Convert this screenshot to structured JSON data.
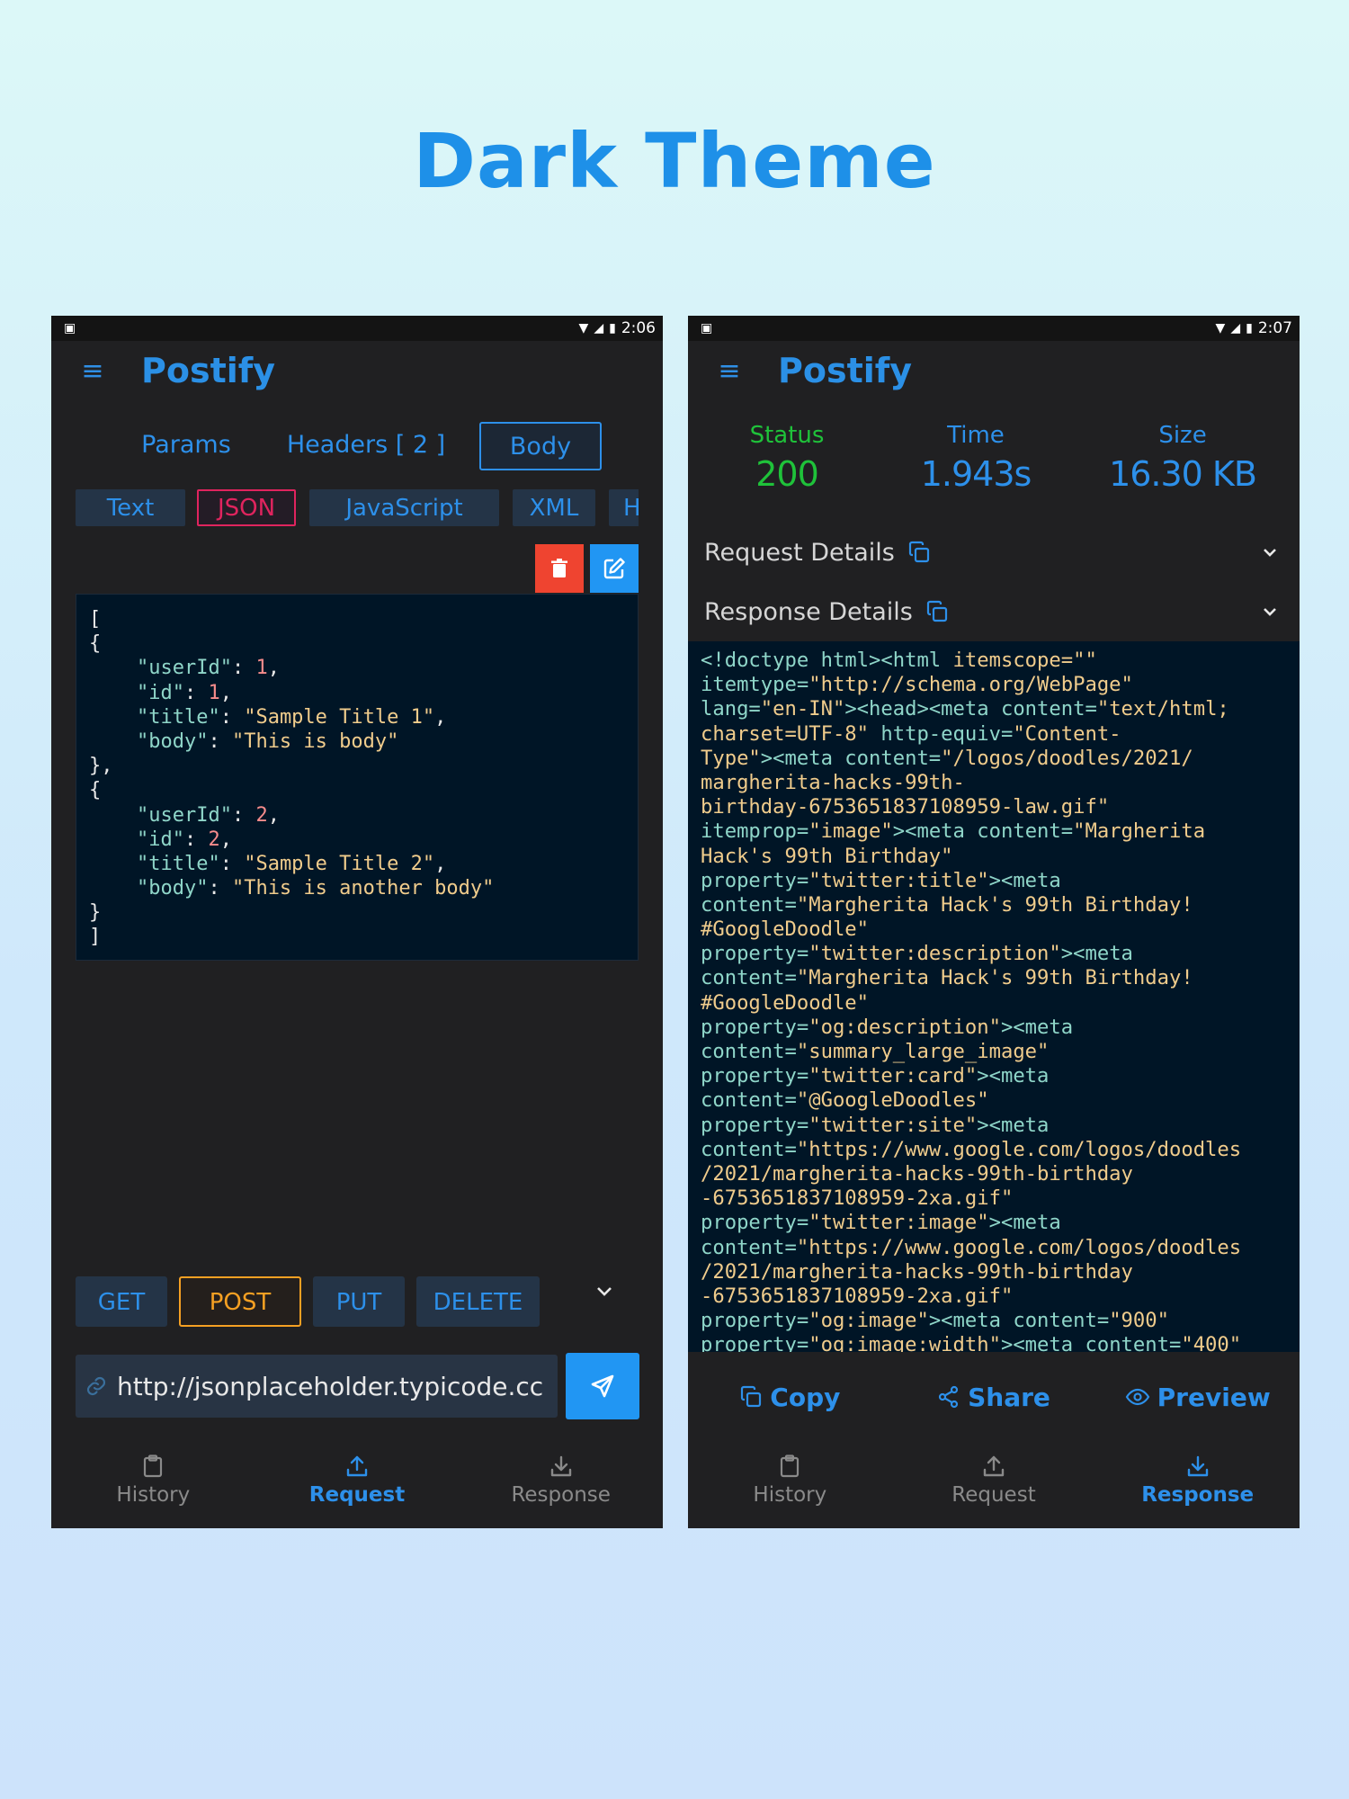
{
  "headline": "Dark Theme",
  "colors": {
    "accent": "#2d90ea",
    "status_green": "#1fc23a",
    "delete_red": "#ef4430",
    "json_pink": "#e0245e",
    "post_orange": "#f5a023",
    "background": "#202022",
    "editor_bg": "#001526"
  },
  "request_screen": {
    "status_bar": {
      "time": "2:06"
    },
    "app_title": "Postify",
    "tabs": [
      {
        "label": "Params"
      },
      {
        "label": "Headers [ 2 ]"
      },
      {
        "label": "Body",
        "active": true
      }
    ],
    "body_types": [
      {
        "label": "Text"
      },
      {
        "label": "JSON",
        "active": true
      },
      {
        "label": "JavaScript"
      },
      {
        "label": "XML"
      },
      {
        "label": "H"
      }
    ],
    "body_lines": [
      [
        {
          "t": "[",
          "c": "p"
        }
      ],
      [
        {
          "t": "{",
          "c": "p"
        }
      ],
      [
        {
          "t": "    \"userId\"",
          "c": "k"
        },
        {
          "t": ": ",
          "c": "p"
        },
        {
          "t": "1",
          "c": "n"
        },
        {
          "t": ",",
          "c": "p"
        }
      ],
      [
        {
          "t": "    \"id\"",
          "c": "k"
        },
        {
          "t": ": ",
          "c": "p"
        },
        {
          "t": "1",
          "c": "n"
        },
        {
          "t": ",",
          "c": "p"
        }
      ],
      [
        {
          "t": "    \"title\"",
          "c": "k"
        },
        {
          "t": ": ",
          "c": "p"
        },
        {
          "t": "\"Sample Title 1\"",
          "c": "s"
        },
        {
          "t": ",",
          "c": "p"
        }
      ],
      [
        {
          "t": "    \"body\"",
          "c": "k"
        },
        {
          "t": ": ",
          "c": "p"
        },
        {
          "t": "\"This is body\"",
          "c": "s"
        }
      ],
      [
        {
          "t": "},",
          "c": "p"
        }
      ],
      [
        {
          "t": "{",
          "c": "p"
        }
      ],
      [
        {
          "t": "    \"userId\"",
          "c": "k"
        },
        {
          "t": ": ",
          "c": "p"
        },
        {
          "t": "2",
          "c": "n"
        },
        {
          "t": ",",
          "c": "p"
        }
      ],
      [
        {
          "t": "    \"id\"",
          "c": "k"
        },
        {
          "t": ": ",
          "c": "p"
        },
        {
          "t": "2",
          "c": "n"
        },
        {
          "t": ",",
          "c": "p"
        }
      ],
      [
        {
          "t": "    \"title\"",
          "c": "k"
        },
        {
          "t": ": ",
          "c": "p"
        },
        {
          "t": "\"Sample Title 2\"",
          "c": "s"
        },
        {
          "t": ",",
          "c": "p"
        }
      ],
      [
        {
          "t": "    \"body\"",
          "c": "k"
        },
        {
          "t": ": ",
          "c": "p"
        },
        {
          "t": "\"This is another body\"",
          "c": "s"
        }
      ],
      [
        {
          "t": "}",
          "c": "p"
        }
      ],
      [
        {
          "t": "]",
          "c": "p"
        }
      ]
    ],
    "methods": [
      {
        "label": "GET"
      },
      {
        "label": "POST",
        "active": true
      },
      {
        "label": "PUT"
      },
      {
        "label": "DELETE"
      }
    ],
    "url_value": "http://jsonplaceholder.typicode.cc",
    "bottom_nav": [
      {
        "label": "History",
        "icon": "clipboard-icon"
      },
      {
        "label": "Request",
        "icon": "upload-icon",
        "active": true
      },
      {
        "label": "Response",
        "icon": "download-icon"
      }
    ]
  },
  "response_screen": {
    "status_bar": {
      "time": "2:07"
    },
    "app_title": "Postify",
    "stats": [
      {
        "label": "Status",
        "value": "200"
      },
      {
        "label": "Time",
        "value": "1.943s"
      },
      {
        "label": "Size",
        "value": "16.30 KB"
      }
    ],
    "request_details_label": "Request Details",
    "response_details_label": "Response Details",
    "code_lines": [
      [
        {
          "t": "<!doctype html><html ",
          "c": "t"
        },
        {
          "t": "itemscope=\"\"",
          "c": "v"
        }
      ],
      [
        {
          "t": "itemtype=",
          "c": "a"
        },
        {
          "t": "\"http://schema.org/WebPage\"",
          "c": "v"
        }
      ],
      [
        {
          "t": "lang=",
          "c": "a"
        },
        {
          "t": "\"en-IN\"",
          "c": "v"
        },
        {
          "t": "><head><meta content=",
          "c": "t"
        },
        {
          "t": "\"text/html;",
          "c": "v"
        }
      ],
      [
        {
          "t": "charset=UTF-8\"",
          "c": "v"
        },
        {
          "t": " http-equiv=",
          "c": "a"
        },
        {
          "t": "\"Content-",
          "c": "v"
        }
      ],
      [
        {
          "t": "Type\"",
          "c": "v"
        },
        {
          "t": "><meta content=",
          "c": "t"
        },
        {
          "t": "\"/logos/doodles/2021/",
          "c": "v"
        }
      ],
      [
        {
          "t": "margherita-hacks-99th-",
          "c": "v"
        }
      ],
      [
        {
          "t": "birthday-6753651837108959-law.gif\"",
          "c": "v"
        }
      ],
      [
        {
          "t": "itemprop=",
          "c": "a"
        },
        {
          "t": "\"image\"",
          "c": "v"
        },
        {
          "t": "><meta content=",
          "c": "t"
        },
        {
          "t": "\"Margherita",
          "c": "v"
        }
      ],
      [
        {
          "t": "Hack's 99th Birthday\"",
          "c": "v"
        }
      ],
      [
        {
          "t": "property=",
          "c": "a"
        },
        {
          "t": "\"twitter:title\"",
          "c": "v"
        },
        {
          "t": "><meta",
          "c": "t"
        }
      ],
      [
        {
          "t": "content=",
          "c": "a"
        },
        {
          "t": "\"Margherita Hack's 99th Birthday!",
          "c": "v"
        }
      ],
      [
        {
          "t": "#GoogleDoodle\"",
          "c": "v"
        }
      ],
      [
        {
          "t": "property=",
          "c": "a"
        },
        {
          "t": "\"twitter:description\"",
          "c": "v"
        },
        {
          "t": "><meta",
          "c": "t"
        }
      ],
      [
        {
          "t": "content=",
          "c": "a"
        },
        {
          "t": "\"Margherita Hack's 99th Birthday!",
          "c": "v"
        }
      ],
      [
        {
          "t": "#GoogleDoodle\"",
          "c": "v"
        }
      ],
      [
        {
          "t": "property=",
          "c": "a"
        },
        {
          "t": "\"og:description\"",
          "c": "v"
        },
        {
          "t": "><meta",
          "c": "t"
        }
      ],
      [
        {
          "t": "content=",
          "c": "a"
        },
        {
          "t": "\"summary_large_image\"",
          "c": "v"
        }
      ],
      [
        {
          "t": "property=",
          "c": "a"
        },
        {
          "t": "\"twitter:card\"",
          "c": "v"
        },
        {
          "t": "><meta",
          "c": "t"
        }
      ],
      [
        {
          "t": "content=",
          "c": "a"
        },
        {
          "t": "\"@GoogleDoodles\"",
          "c": "v"
        }
      ],
      [
        {
          "t": "property=",
          "c": "a"
        },
        {
          "t": "\"twitter:site\"",
          "c": "v"
        },
        {
          "t": "><meta",
          "c": "t"
        }
      ],
      [
        {
          "t": "content=",
          "c": "a"
        },
        {
          "t": "\"https://www.google.com/logos/doodles",
          "c": "v"
        }
      ],
      [
        {
          "t": "/2021/margherita-hacks-99th-birthday",
          "c": "v"
        }
      ],
      [
        {
          "t": "-6753651837108959-2xa.gif\"",
          "c": "v"
        }
      ],
      [
        {
          "t": "property=",
          "c": "a"
        },
        {
          "t": "\"twitter:image\"",
          "c": "v"
        },
        {
          "t": "><meta",
          "c": "t"
        }
      ],
      [
        {
          "t": "content=",
          "c": "a"
        },
        {
          "t": "\"https://www.google.com/logos/doodles",
          "c": "v"
        }
      ],
      [
        {
          "t": "/2021/margherita-hacks-99th-birthday",
          "c": "v"
        }
      ],
      [
        {
          "t": "-6753651837108959-2xa.gif\"",
          "c": "v"
        }
      ],
      [
        {
          "t": "property=",
          "c": "a"
        },
        {
          "t": "\"og:image\"",
          "c": "v"
        },
        {
          "t": "><meta content=",
          "c": "t"
        },
        {
          "t": "\"900\"",
          "c": "v"
        }
      ],
      [
        {
          "t": "property=",
          "c": "a"
        },
        {
          "t": "\"og:image:width\"",
          "c": "v"
        },
        {
          "t": "><meta content=",
          "c": "t"
        },
        {
          "t": "\"400\"",
          "c": "v"
        }
      ]
    ],
    "actions": [
      {
        "label": "Copy",
        "icon": "copy-icon"
      },
      {
        "label": "Share",
        "icon": "share-icon"
      },
      {
        "label": "Preview",
        "icon": "eye-icon"
      }
    ],
    "bottom_nav": [
      {
        "label": "History",
        "icon": "clipboard-icon"
      },
      {
        "label": "Request",
        "icon": "upload-icon"
      },
      {
        "label": "Response",
        "icon": "download-icon",
        "active": true
      }
    ]
  }
}
